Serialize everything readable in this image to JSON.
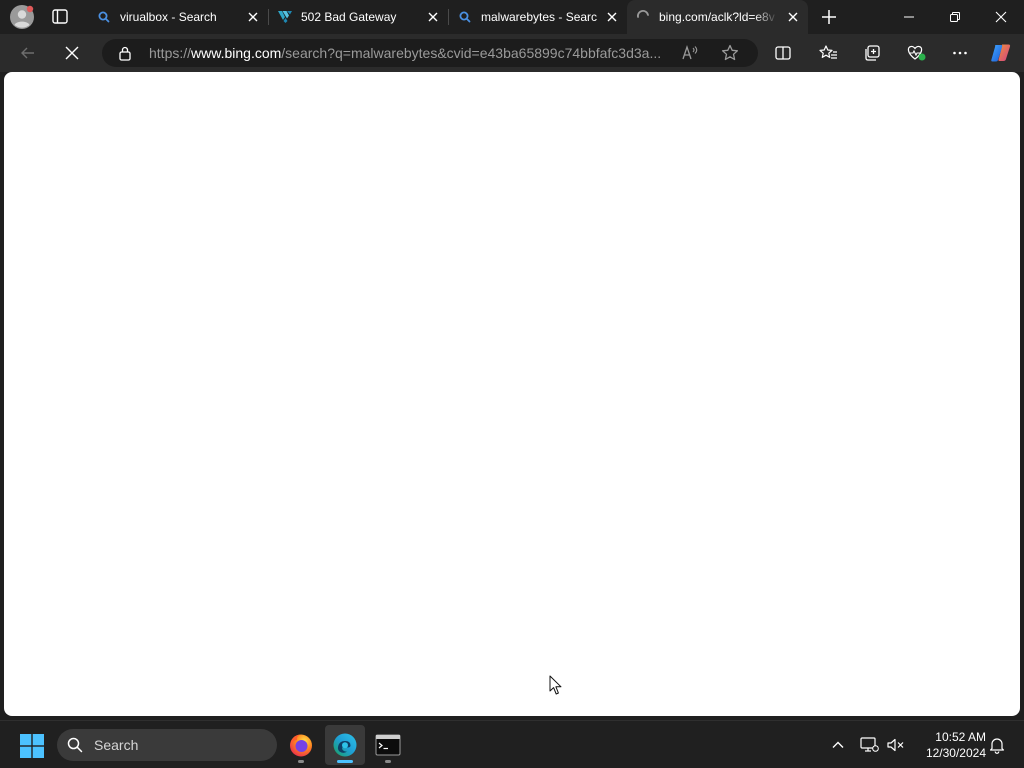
{
  "browser": {
    "tabs": [
      {
        "title": "virualbox - Search",
        "favicon": "bing-search-icon",
        "active": false
      },
      {
        "title": "502 Bad Gateway",
        "favicon": "vultr-logo-icon",
        "active": false
      },
      {
        "title": "malwarebytes - Search",
        "favicon": "bing-search-icon",
        "active": false
      },
      {
        "title": "bing.com/aclk?ld=e8v",
        "favicon": "loading-spinner-icon",
        "active": true
      }
    ],
    "address_bar": {
      "scheme": "https://",
      "host": "www.bing.com",
      "path": "/search?q=malwarebytes&cvid=e43ba65899c74bbfafc3d3a..."
    },
    "page_state": "loading"
  },
  "taskbar": {
    "search_label": "Search",
    "apps": [
      "firefox-icon",
      "edge-icon",
      "terminal-icon"
    ],
    "active_app": "edge-icon",
    "time": "10:52 AM",
    "date": "12/30/2024"
  },
  "colors": {
    "tabbar_bg": "#1f1f1f",
    "toolbar_bg": "#2b2b2b",
    "address_bg": "#1c1c1c",
    "taskbar_bg": "#202020",
    "accent": "#4cc2ff",
    "page_bg": "#ffffff"
  }
}
